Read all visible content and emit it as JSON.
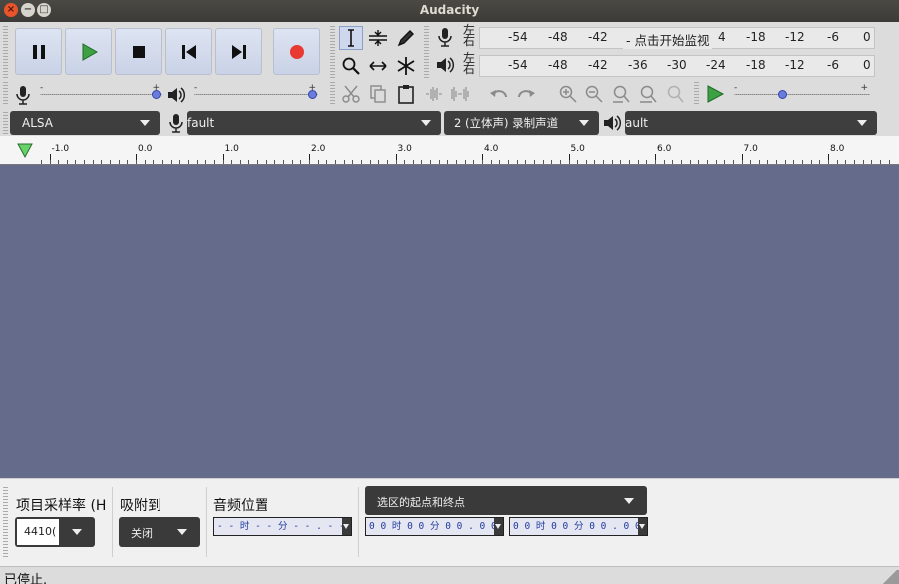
{
  "window": {
    "title": "Audacity"
  },
  "transport": {
    "buttons": [
      "pause",
      "play",
      "stop",
      "skip-start",
      "skip-end",
      "record"
    ],
    "record_color": "#e83a33",
    "play_color": "#3da143"
  },
  "meters": {
    "record_channels": "左\n右",
    "playback_channels": "左\n右",
    "record_ticks_left": [
      "-54",
      "-48",
      "-42"
    ],
    "record_hint": "- 点击开始监视",
    "record_ticks_right": [
      "4",
      "-18",
      "-12",
      "-6",
      "0"
    ],
    "playback_ticks": [
      "-54",
      "-48",
      "-42",
      "-36",
      "-30",
      "-24",
      "-18",
      "-12",
      "-6",
      "0"
    ]
  },
  "mixer": {
    "record_minus": "-",
    "record_plus": "+",
    "record_level": 1.0,
    "play_minus": "-",
    "play_plus": "+",
    "play_level": 1.0
  },
  "playat": {
    "minus": "-",
    "plus": "+",
    "speed": 0.35
  },
  "devices": {
    "host": "ALSA",
    "record_device": "fault",
    "channels": "2 (立体声) 录制声道",
    "playback_device": "ault"
  },
  "ruler": {
    "labels": [
      "-1.0",
      "0.0",
      "1.0",
      "2.0",
      "3.0",
      "4.0",
      "5.0",
      "6.0",
      "7.0",
      "8.0"
    ]
  },
  "selection": {
    "rate_label": "项目采样率 (H",
    "rate_value": "4410(",
    "snap_label": "吸附到",
    "snap_value": "关闭",
    "audio_pos_label": "音频位置",
    "audio_pos_value": "- - 时 - - 分 - - . - - - 秒",
    "selection_mode": "选区的起点和终点",
    "sel_start": "0 0 时 0 0 分 0 0 . 0 0 0 秒",
    "sel_end": "0 0 时 0 0 分 0 0 . 0 0 0 秒"
  },
  "status": {
    "text": "已停止."
  }
}
